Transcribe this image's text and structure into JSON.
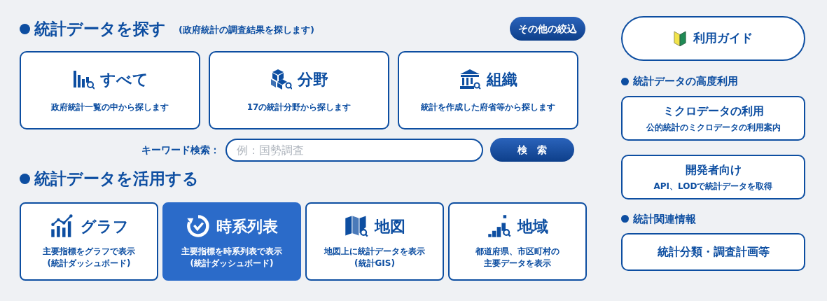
{
  "search_section": {
    "title": "統計データを探す",
    "subtitle": "(政府統計の調査結果を探します)",
    "filter_button": "その他の絞込",
    "cards": [
      {
        "title": "すべて",
        "description": "政府統計一覧の中から探します"
      },
      {
        "title": "分野",
        "description": "17の統計分野から探します"
      },
      {
        "title": "組織",
        "description": "統計を作成した府省等から探します"
      }
    ],
    "keyword_label": "キーワード検索：",
    "keyword_field": {
      "placeholder": "例：国勢調査"
    },
    "search_button": "検　索"
  },
  "use_section": {
    "title": "統計データを活用する",
    "cards": [
      {
        "title": "グラフ",
        "description_lines": [
          "主要指標をグラフで表示",
          "(統計ダッシュボード)"
        ],
        "selected": false
      },
      {
        "title": "時系列表",
        "description_lines": [
          "主要指標を時系列表で表示",
          "(統計ダッシュボード)"
        ],
        "selected": true
      },
      {
        "title": "地図",
        "description_lines": [
          "地図上に統計データを表示",
          "(統計GIS)"
        ],
        "selected": false
      },
      {
        "title": "地域",
        "description_lines": [
          "都道府県、市区町村の",
          "主要データを表示"
        ],
        "selected": false
      }
    ]
  },
  "sidebar": {
    "guide_button": "利用ガイド",
    "groups": [
      {
        "heading": "統計データの高度利用",
        "links": [
          {
            "title": "ミクロデータの利用",
            "description": "公的統計のミクロデータの利用案内"
          },
          {
            "title": "開発者向け",
            "description": "API、LODで統計データを取得"
          }
        ]
      },
      {
        "heading": "統計関連情報",
        "links": [
          {
            "title": "統計分類・調査計画等"
          }
        ]
      }
    ]
  }
}
